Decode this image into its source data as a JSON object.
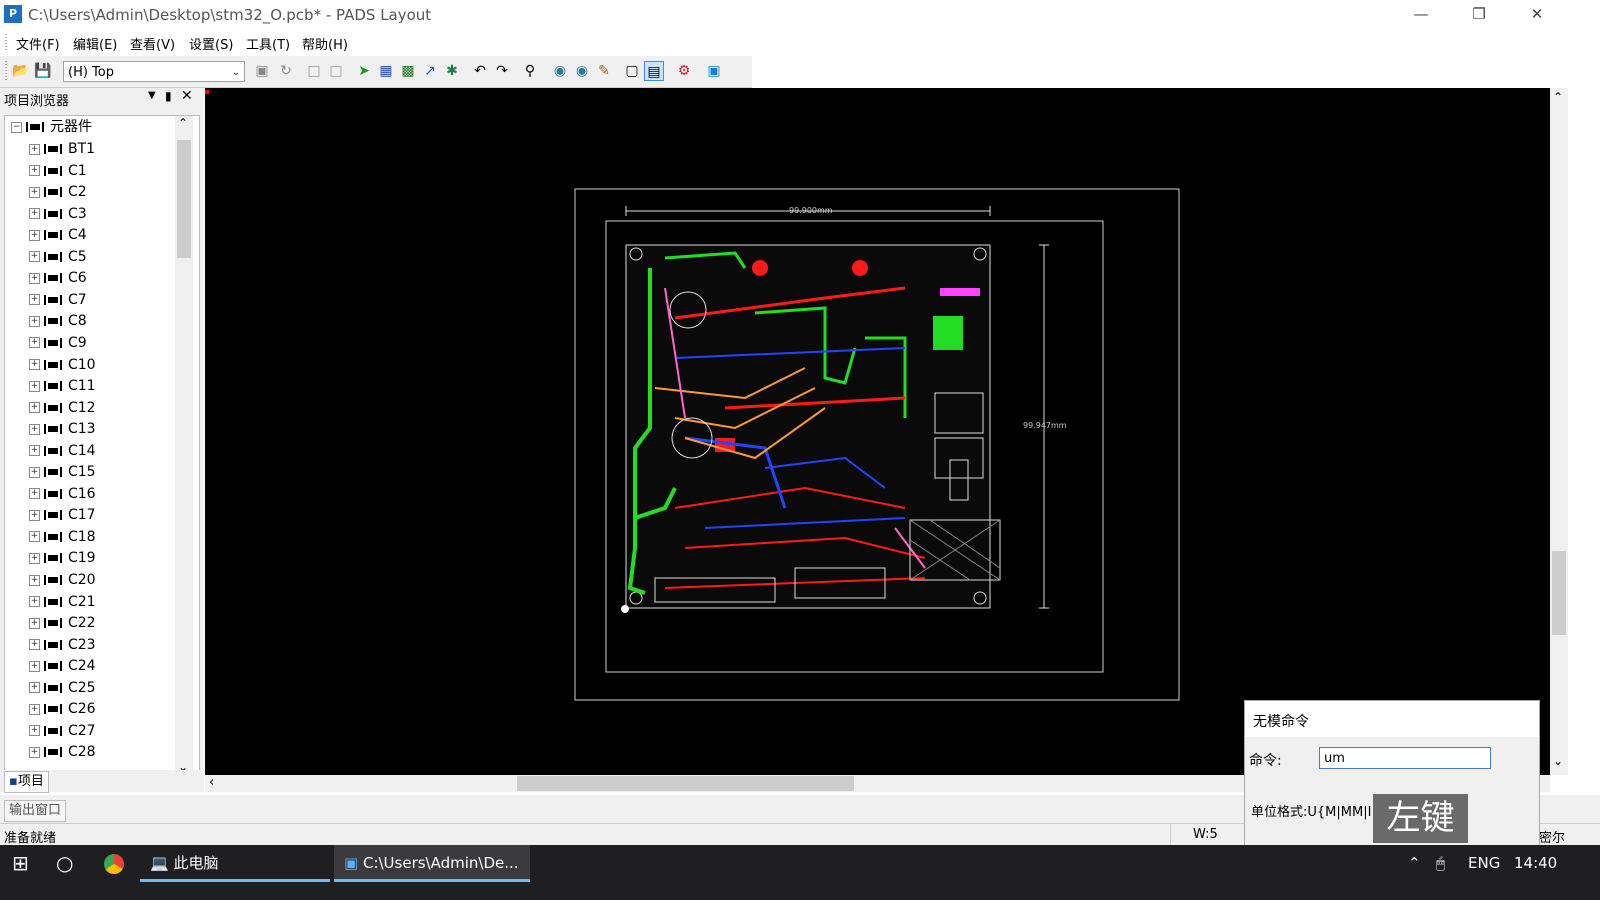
{
  "window": {
    "title": "C:\\Users\\Admin\\Desktop\\stm32_O.pcb* - PADS Layout",
    "app_icon": "pads-icon",
    "controls": [
      "minimize-icon",
      "restore-icon",
      "close-icon"
    ]
  },
  "menu": [
    "文件(F)",
    "编辑(E)",
    "查看(V)",
    "设置(S)",
    "工具(T)",
    "帮助(H)"
  ],
  "toolbar": {
    "layer_select": "(H) Top",
    "icons": [
      "open-icon",
      "save-icon",
      "layer-dropdown",
      "pad-stack-icon",
      "refresh-icon",
      "board-icon",
      "board2-icon",
      "route-icon",
      "grid-icon",
      "matrix-icon",
      "trace-icon",
      "pad-icon",
      "undo-icon",
      "redo-icon",
      "zoom-icon",
      "view-icon",
      "view2-icon",
      "paint-icon",
      "select-icon",
      "window-icon",
      "drc-icon",
      "router-icon"
    ]
  },
  "project_browser": {
    "title": "项目浏览器",
    "root": "元器件",
    "items": [
      "BT1",
      "C1",
      "C2",
      "C3",
      "C4",
      "C5",
      "C6",
      "C7",
      "C8",
      "C9",
      "C10",
      "C11",
      "C12",
      "C13",
      "C14",
      "C15",
      "C16",
      "C17",
      "C18",
      "C19",
      "C20",
      "C21",
      "C22",
      "C23",
      "C24",
      "C25",
      "C26",
      "C27",
      "C28"
    ],
    "tab_label": "项目"
  },
  "pcb": {
    "dim_horizontal": "99.900mm",
    "dim_vertical": "99.947mm"
  },
  "output_window_label": "输出窗口",
  "status": {
    "ready": "准备就绪",
    "width": "W:5",
    "right_clip": "密尔"
  },
  "command_dialog": {
    "title": "无模命令",
    "command_label": "命令:",
    "command_value": "um",
    "unit_format": "单位格式:U{M|MM|I}"
  },
  "watermark": "左键",
  "taskbar": {
    "this_pc": "此电脑",
    "active_window": "C:\\Users\\Admin\\De...",
    "lang": "ENG",
    "time": "14:40"
  },
  "colors": {
    "canvas_bg": "#000000",
    "trace_red": "#ff1a1a",
    "trace_green": "#22dd22",
    "trace_blue": "#2244ff",
    "trace_orange": "#ff9933",
    "trace_pink": "#ff66cc",
    "taskbar": "#1f1f22"
  }
}
